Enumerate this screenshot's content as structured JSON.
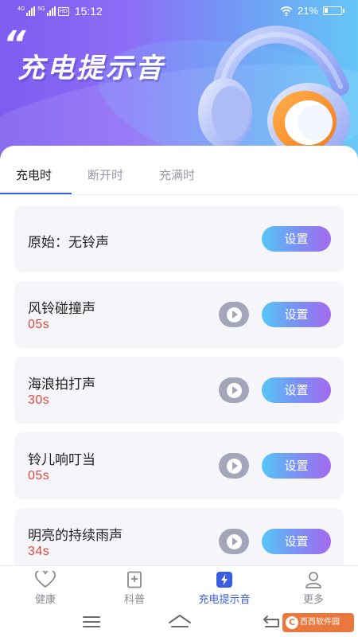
{
  "status_bar": {
    "net1": "4G",
    "net2": "5G",
    "hd": "HD",
    "time": "15:12",
    "battery": "21%"
  },
  "hero": {
    "title": "充电提示音"
  },
  "tabs": [
    {
      "label": "充电时",
      "active": true
    },
    {
      "label": "断开时",
      "active": false
    },
    {
      "label": "充满时",
      "active": false
    }
  ],
  "sounds": [
    {
      "name": "原始：无铃声",
      "duration": "",
      "has_play": false,
      "action": "设置"
    },
    {
      "name": "风铃碰撞声",
      "duration": "05s",
      "has_play": true,
      "action": "设置"
    },
    {
      "name": "海浪拍打声",
      "duration": "30s",
      "has_play": true,
      "action": "设置"
    },
    {
      "name": "铃儿响叮当",
      "duration": "05s",
      "has_play": true,
      "action": "设置"
    },
    {
      "name": "明亮的持续雨声",
      "duration": "34s",
      "has_play": true,
      "action": "设置"
    }
  ],
  "bottom_nav": [
    {
      "label": "健康",
      "icon": "heart-icon",
      "active": false
    },
    {
      "label": "科普",
      "icon": "book-icon",
      "active": false
    },
    {
      "label": "充电提示音",
      "icon": "lightning-icon",
      "active": true
    },
    {
      "label": "更多",
      "icon": "person-icon",
      "active": false
    }
  ],
  "watermark": {
    "text": "西西软件园"
  },
  "colors": {
    "accent": "#3a5ee0",
    "duration": "#e0483e",
    "button_start": "#57c6f7",
    "button_end": "#a36bef",
    "card_bg": "#f6f6fa"
  }
}
